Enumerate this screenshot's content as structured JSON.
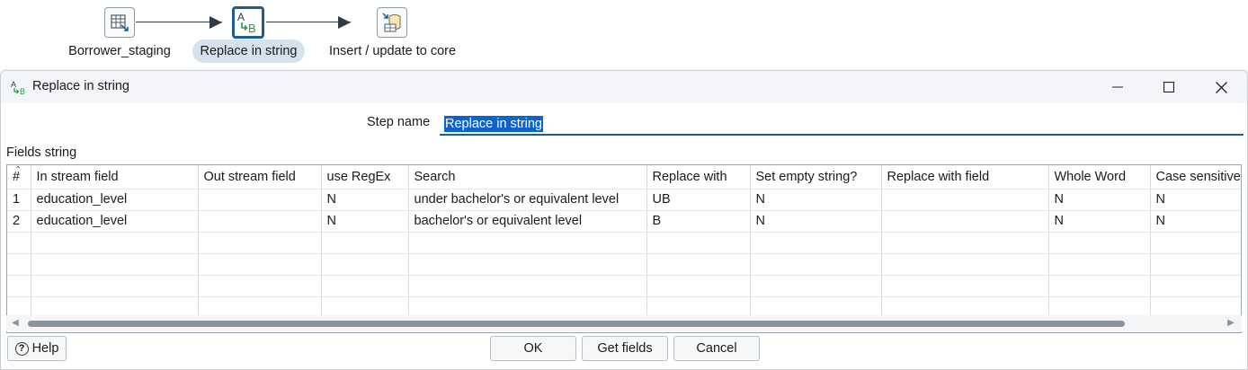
{
  "canvas": {
    "nodes": [
      {
        "label": "Borrower_staging",
        "icon": "table-input-icon"
      },
      {
        "label": "Replace in string",
        "icon": "replace-in-string-icon"
      },
      {
        "label": "Insert / update to core",
        "icon": "insert-update-icon"
      }
    ]
  },
  "dialog": {
    "title": "Replace in string",
    "title_icon_text": "AB",
    "step_name_label": "Step name",
    "step_name_value": "Replace in string",
    "fields_label": "Fields string",
    "table": {
      "columns": [
        "#",
        "In stream field",
        "Out stream field",
        "use RegEx",
        "Search",
        "Replace with",
        "Set empty string?",
        "Replace with field",
        "Whole Word",
        "Case sensitive"
      ],
      "rows": [
        [
          "1",
          "education_level",
          "",
          "N",
          "under bachelor's or equivalent level",
          "UB",
          "N",
          "",
          "N",
          "N"
        ],
        [
          "2",
          "education_level",
          "",
          "N",
          "bachelor's or equivalent level",
          "B",
          "N",
          "",
          "N",
          "N"
        ]
      ],
      "empty_rows": 4
    },
    "buttons": {
      "help": "Help",
      "ok": "OK",
      "get_fields": "Get fields",
      "cancel": "Cancel"
    }
  }
}
